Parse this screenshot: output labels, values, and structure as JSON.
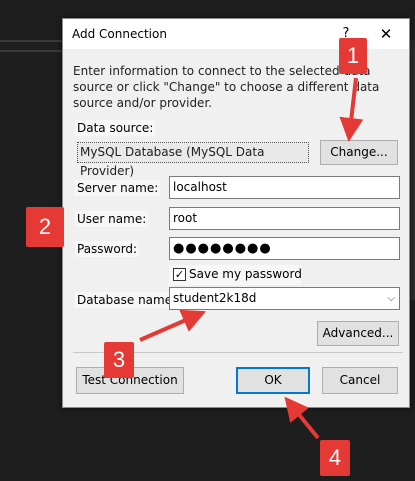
{
  "dialog": {
    "title": "Add Connection",
    "help_glyph": "?",
    "close_glyph": "✕",
    "info_text": "Enter information to connect to the selected data source or click \"Change\" to choose a different data source and/or provider."
  },
  "data_source": {
    "label": "Data source:",
    "value": "MySQL Database (MySQL Data Provider)",
    "change_label": "Change..."
  },
  "server_name": {
    "label": "Server name:",
    "value": "localhost"
  },
  "user_name": {
    "label": "User name:",
    "value": "root"
  },
  "password": {
    "label": "Password:",
    "value": "●●●●●●●●"
  },
  "save_password": {
    "label": "Save my password",
    "checked_glyph": "✓"
  },
  "database_name": {
    "label": "Database name:",
    "value": "student2k18d",
    "arrow_glyph": "⌵"
  },
  "buttons": {
    "advanced": "Advanced...",
    "test_connection": "Test Connection",
    "ok": "OK",
    "cancel": "Cancel"
  },
  "annotations": {
    "badge_1": "1",
    "badge_2": "2",
    "badge_3": "3",
    "badge_4": "4",
    "color": "#e53935"
  }
}
